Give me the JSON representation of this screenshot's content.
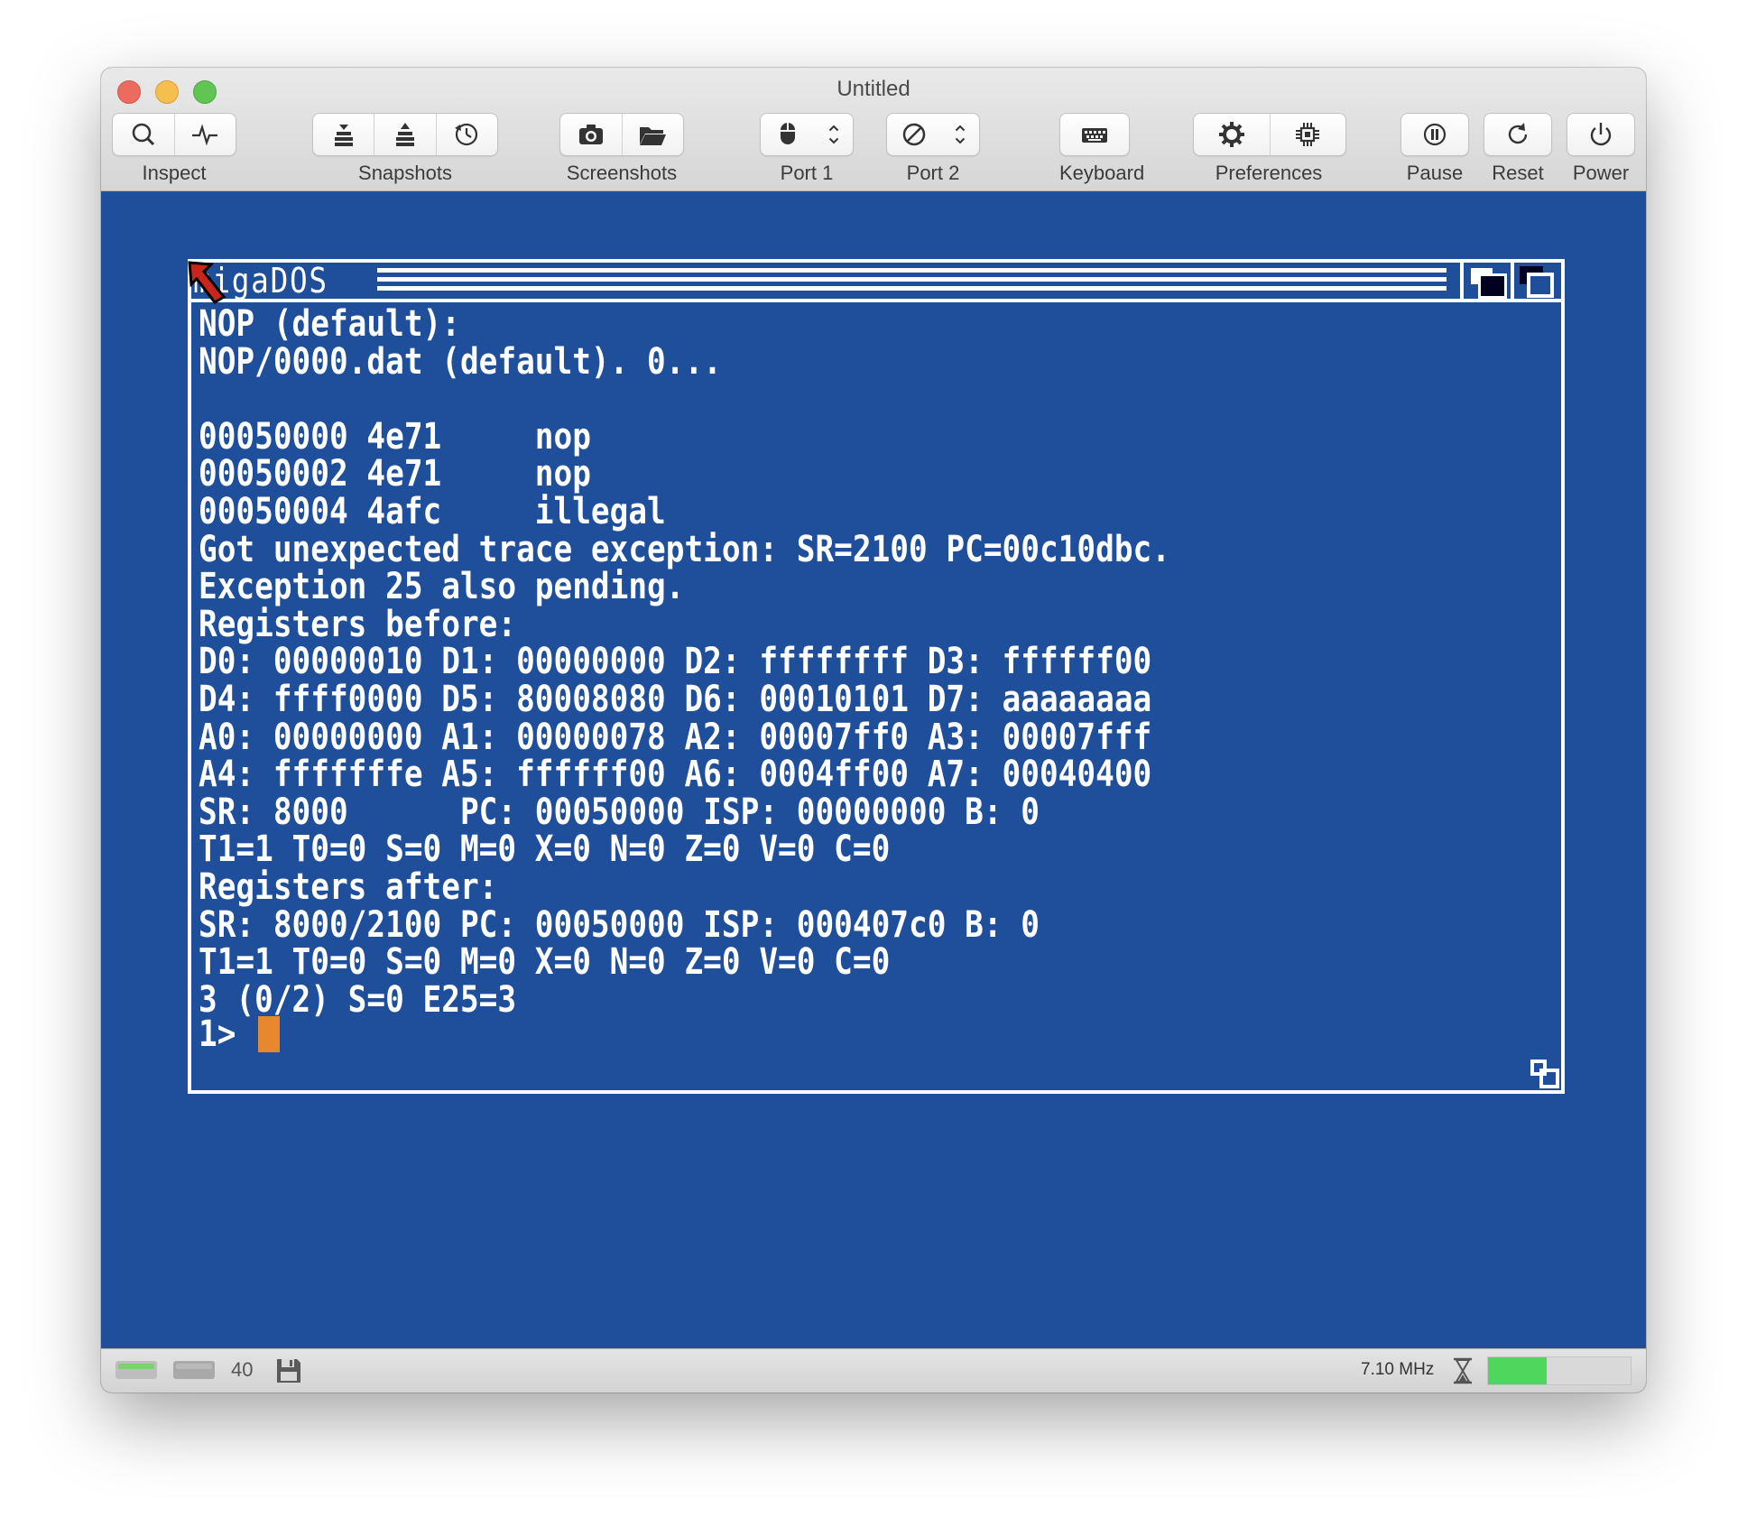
{
  "window": {
    "title": "Untitled"
  },
  "toolbar": {
    "inspect_label": "Inspect",
    "snapshots_label": "Snapshots",
    "screenshots_label": "Screenshots",
    "port1_label": "Port 1",
    "port2_label": "Port 2",
    "keyboard_label": "Keyboard",
    "preferences_label": "Preferences",
    "pause_label": "Pause",
    "reset_label": "Reset",
    "power_label": "Power"
  },
  "amiga": {
    "window_title": "migaDOS",
    "terminal_text": "NOP (default):\nNOP/0000.dat (default). 0...\n\n00050000 4e71     nop\n00050002 4e71     nop\n00050004 4afc     illegal\nGot unexpected trace exception: SR=2100 PC=00c10dbc.\nException 25 also pending.\nRegisters before:\nD0: 00000010 D1: 00000000 D2: ffffffff D3: ffffff00\nD4: ffff0000 D5: 80008080 D6: 00010101 D7: aaaaaaaa\nA0: 00000000 A1: 00000078 A2: 00007ff0 A3: 00007fff\nA4: fffffffe A5: ffffff00 A6: 0004ff00 A7: 00040400\nSR: 8000      PC: 00050000 ISP: 00000000 B: 0\nT1=1 T0=0 S=0 M=0 X=0 N=0 Z=0 V=0 C=0\nRegisters after:\nSR: 8000/2100 PC: 00050000 ISP: 000407c0 B: 0\nT1=1 T0=0 S=0 M=0 X=0 N=0 Z=0 V=0 C=0\n3 (0/2) S=0 E25=3",
    "prompt": "1> ",
    "cursor_color": "#e8882e",
    "screen_color": "#1f4f9a"
  },
  "statusbar": {
    "drive_count": "40",
    "clock": "7.10 MHz",
    "speed_fraction": 0.41,
    "drive0_led_color": "#7bd36b",
    "drive1_led_color": "#b9b9b9"
  }
}
